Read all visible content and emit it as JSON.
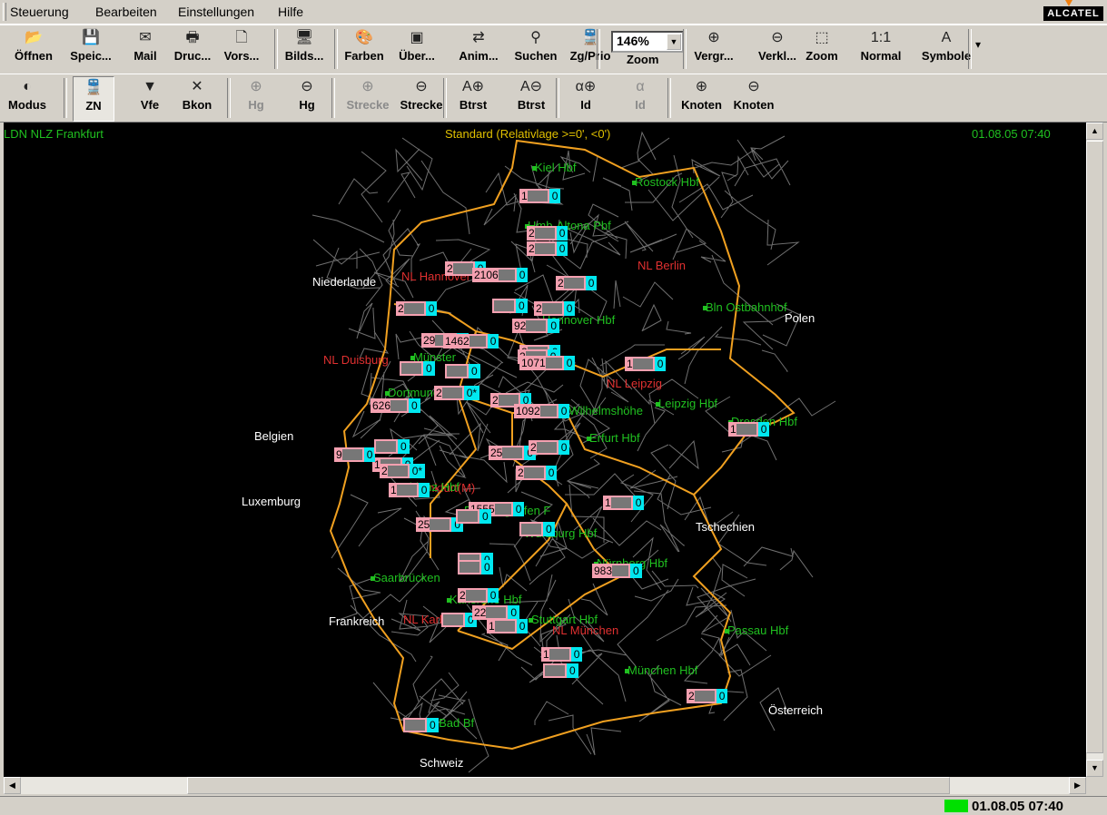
{
  "menu": [
    "Steuerung",
    "Bearbeiten",
    "Einstellungen",
    "Hilfe"
  ],
  "brand": "ALCATEL",
  "toolbar1": [
    {
      "label": "Öffnen",
      "icon": "open-folder-icon",
      "glyph": "📂"
    },
    {
      "label": "Speic...",
      "icon": "save-disk-icon",
      "glyph": "💾"
    },
    {
      "label": "Mail",
      "icon": "mail-icon",
      "glyph": "✉"
    },
    {
      "label": "Druc...",
      "icon": "printer-icon",
      "glyph": "🖶"
    },
    {
      "label": "Vors...",
      "icon": "print-preview-icon",
      "glyph": "🗋"
    },
    {
      "label": "Bilds...",
      "icon": "monitor-icon",
      "glyph": "🖥"
    },
    {
      "label": "Farben",
      "icon": "palette-icon",
      "glyph": "🎨"
    },
    {
      "label": "Über...",
      "icon": "overview-icon",
      "glyph": "▣"
    },
    {
      "label": "Anim...",
      "icon": "animation-icon",
      "glyph": "⇄"
    },
    {
      "label": "Suchen",
      "icon": "binoculars-icon",
      "glyph": "⚲"
    },
    {
      "label": "Zg/Prio",
      "icon": "train-priority-icon",
      "glyph": "🚆"
    },
    {
      "label": "Zoom",
      "icon": "zoom-select-icon",
      "glyph": ""
    },
    {
      "label": "Vergr...",
      "icon": "zoom-in-icon",
      "glyph": "⊕"
    },
    {
      "label": "Verkl...",
      "icon": "zoom-out-icon",
      "glyph": "⊖"
    },
    {
      "label": "Zoom",
      "icon": "zoom-area-icon",
      "glyph": "⬚"
    },
    {
      "label": "Normal",
      "icon": "normal-size-icon",
      "glyph": "1:1"
    },
    {
      "label": "Symbole",
      "icon": "symbols-font-icon",
      "glyph": "A"
    }
  ],
  "zoom_value": "146%",
  "toolbar2": [
    {
      "label": "Modus",
      "icon": "mode-globe-icon",
      "glyph": "◐",
      "state": "normal"
    },
    {
      "label": "ZN",
      "icon": "train-number-icon",
      "glyph": "🚆",
      "state": "pressed"
    },
    {
      "label": "Vfe",
      "icon": "triangle-down-icon",
      "glyph": "▼",
      "state": "normal"
    },
    {
      "label": "Bkon",
      "icon": "cross-icon",
      "glyph": "✕",
      "state": "normal"
    },
    {
      "label": "Hg",
      "icon": "hg-plus-icon",
      "glyph": "⊕",
      "state": "disabled"
    },
    {
      "label": "Hg",
      "icon": "hg-minus-icon",
      "glyph": "⊖",
      "state": "normal"
    },
    {
      "label": "Strecke",
      "icon": "line-plus-icon",
      "glyph": "⊕",
      "state": "disabled"
    },
    {
      "label": "Strecke",
      "icon": "line-minus-icon",
      "glyph": "⊖",
      "state": "normal"
    },
    {
      "label": "Btrst",
      "icon": "btrst-plus-icon",
      "glyph": "A⊕",
      "state": "normal"
    },
    {
      "label": "Btrst",
      "icon": "btrst-minus-icon",
      "glyph": "A⊖",
      "state": "normal"
    },
    {
      "label": "Id",
      "icon": "id-plus-icon",
      "glyph": "α⊕",
      "state": "normal"
    },
    {
      "label": "Id",
      "icon": "id-minus-icon",
      "glyph": "α",
      "state": "disabled"
    },
    {
      "label": "Knoten",
      "icon": "node-plus-icon",
      "glyph": "⊕",
      "state": "normal"
    },
    {
      "label": "Knoten",
      "icon": "node-minus-icon",
      "glyph": "⊖",
      "state": "normal"
    }
  ],
  "map": {
    "top_left": "LDN NLZ Frankfurt",
    "top_center": "Standard (Relativlage >=0', <0')",
    "top_right": "01.08.05 07:40",
    "countries": [
      "Niederlande",
      "Polen",
      "Belgien",
      "Luxemburg",
      "Tschechien",
      "Frankreich",
      "Österreich",
      "Schweiz"
    ],
    "regions": [
      "NL Hannover",
      "NL Berlin",
      "NL Duisburg",
      "NL Leipzig",
      "NL Frankfurt(M)",
      "NL München",
      "NL Karlsruhe"
    ],
    "stations": [
      "Kiel Hbf",
      "Rostock Hbf",
      "Hmb-Altona Pbf",
      "Bln Ostbahnhof",
      "Münster",
      "Dortmund Hbf",
      "Kassel-Wilhelmshöhe",
      "Leipzig Hbf",
      "Dresden Hbf",
      "Erfurt Hbf",
      "Koblenz Hbf",
      "Ffm Flughafen F",
      "Würzburg Hbf",
      "Nürnberg Hbf",
      "Saarbrücken",
      "Karlsruhe Hbf",
      "Stuttgart Hbf",
      "Passau Hbf",
      "München Hbf",
      "Basel Bad Bf",
      "Hannover Hbf"
    ],
    "trains": [
      {
        "num": "1",
        "count": "0"
      },
      {
        "num": "2",
        "count": "0"
      },
      {
        "num": "2",
        "count": "0"
      },
      {
        "num": "2",
        "count": "0"
      },
      {
        "num": "2106",
        "count": "0"
      },
      {
        "num": "2",
        "count": "0"
      },
      {
        "num": "2",
        "count": "0"
      },
      {
        "num": "",
        "count": "0"
      },
      {
        "num": "2",
        "count": "0"
      },
      {
        "num": "92",
        "count": "0"
      },
      {
        "num": "2",
        "count": "0"
      },
      {
        "num": "29",
        "count": "0"
      },
      {
        "num": "1462",
        "count": "0"
      },
      {
        "num": "2",
        "count": "0"
      },
      {
        "num": "1071",
        "count": "0"
      },
      {
        "num": "",
        "count": "0"
      },
      {
        "num": "",
        "count": "0"
      },
      {
        "num": "1",
        "count": "0"
      },
      {
        "num": "626",
        "count": "0"
      },
      {
        "num": "2",
        "count": "0*"
      },
      {
        "num": "2",
        "count": "0"
      },
      {
        "num": "1092",
        "count": "0"
      },
      {
        "num": "25",
        "count": "0"
      },
      {
        "num": "2",
        "count": "0"
      },
      {
        "num": "1",
        "count": "0"
      },
      {
        "num": "9",
        "count": "0"
      },
      {
        "num": "",
        "count": "0"
      },
      {
        "num": "2",
        "count": "0*"
      },
      {
        "num": "2",
        "count": "0"
      },
      {
        "num": "1",
        "count": "0"
      },
      {
        "num": "1",
        "count": "0"
      },
      {
        "num": "1",
        "count": "0"
      },
      {
        "num": "1555",
        "count": "0"
      },
      {
        "num": "25",
        "count": "0"
      },
      {
        "num": "",
        "count": "0"
      },
      {
        "num": "",
        "count": "0"
      },
      {
        "num": "",
        "count": "0"
      },
      {
        "num": "983",
        "count": "0"
      },
      {
        "num": "",
        "count": "0"
      },
      {
        "num": "2",
        "count": "0"
      },
      {
        "num": "",
        "count": "0"
      },
      {
        "num": "22",
        "count": "0"
      },
      {
        "num": "1",
        "count": "0"
      },
      {
        "num": "1",
        "count": "0"
      },
      {
        "num": "",
        "count": "0"
      },
      {
        "num": "2",
        "count": "0"
      },
      {
        "num": "",
        "count": "0"
      }
    ]
  },
  "status_time": "01.08.05 07:40"
}
